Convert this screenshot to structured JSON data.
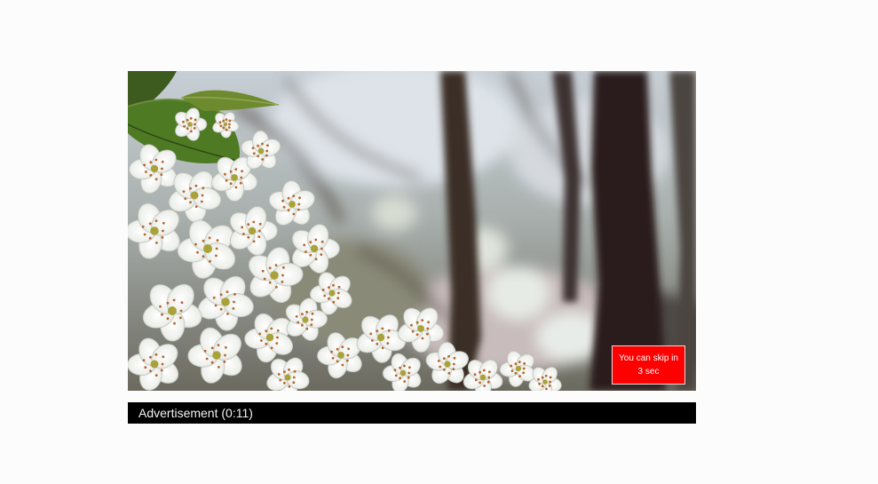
{
  "ad": {
    "skip_line1": "You can skip in",
    "skip_line2": "3 sec",
    "label": "Advertisement (0:11)"
  },
  "colors": {
    "skip_background": "#fe0000",
    "ad_bar_background": "#000000",
    "page_background": "#fcfcfc"
  },
  "video": {
    "subject": "white cherry blossoms in front of blurred tree trunks"
  }
}
